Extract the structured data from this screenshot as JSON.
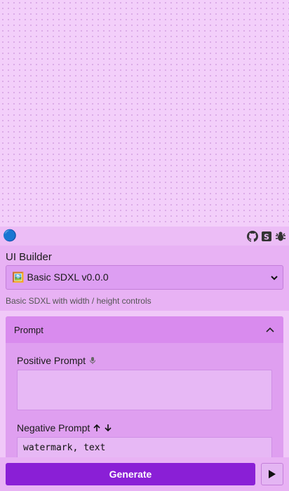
{
  "toolbar": {
    "logo_icon": "🔵",
    "icons": [
      "github-icon",
      "s-box-icon",
      "bug-icon"
    ]
  },
  "builder": {
    "label": "UI Builder",
    "selected_emoji": "🖼️",
    "selected": "Basic SDXL v0.0.0",
    "description": "Basic SDXL with width / height controls"
  },
  "prompt_panel": {
    "title": "Prompt",
    "positive_label": "Positive Prompt",
    "positive_value": "",
    "negative_label": "Negative Prompt",
    "negative_value": "watermark, text"
  },
  "actions": {
    "generate_label": "Generate"
  },
  "colors": {
    "accent": "#8a1fd6",
    "background": "#f0c8f8"
  }
}
